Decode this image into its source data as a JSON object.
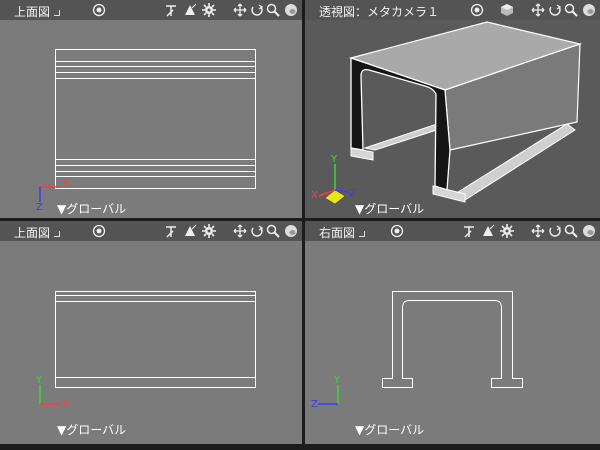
{
  "viewports": {
    "top_left": {
      "title": "上面図",
      "footer": "▼グローバル"
    },
    "top_right": {
      "title": "透視図：メタカメラ１",
      "footer": "▼グローバル"
    },
    "bottom_left": {
      "title": "上面図",
      "footer": "▼グローバル"
    },
    "bottom_right": {
      "title": "右面図",
      "footer": "▼グローバル"
    }
  },
  "axes": {
    "x": "X",
    "y": "Y",
    "z": "Z"
  },
  "icons": [
    "target-icon",
    "pan-icon",
    "rotate-icon",
    "settings-icon",
    "move-icon",
    "orbit-icon",
    "zoom-icon",
    "sphere-icon",
    "cube-icon"
  ],
  "colors": {
    "axis_x": "#ff3b3b",
    "axis_y": "#2fe03a",
    "axis_z": "#3a3aff",
    "wire": "#ffffff",
    "viewport_bg": "#7b7b7b",
    "header_bg": "#545454"
  }
}
